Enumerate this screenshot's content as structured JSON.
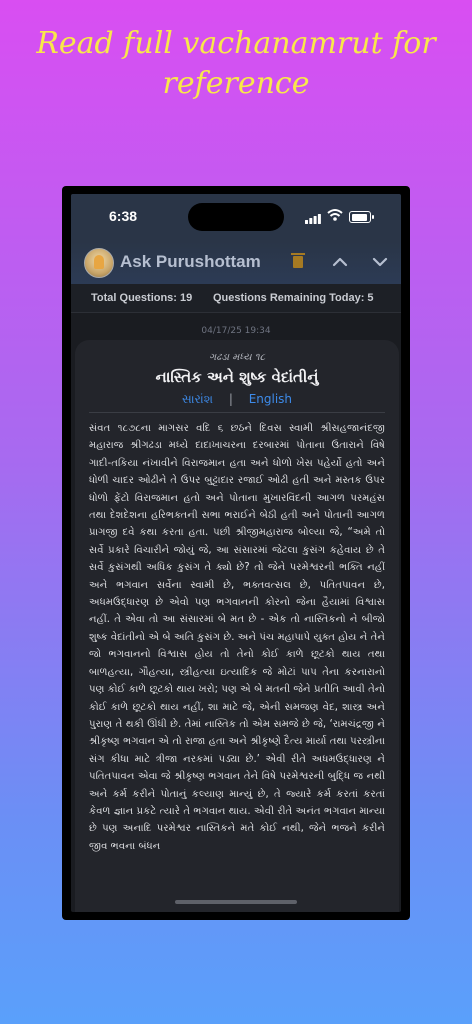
{
  "headline": "Read full vachanamrut for reference",
  "status": {
    "time": "6:38"
  },
  "app": {
    "title": "Ask Purushottam"
  },
  "icons": {
    "avatar": "profile-avatar-icon",
    "trash": "trash-icon",
    "up": "chevron-up-icon",
    "down": "chevron-down-icon"
  },
  "stats": {
    "total": "Total Questions: 19",
    "remaining": "Questions Remaining Today: 5"
  },
  "message": {
    "timestamp": "04/17/25 19:34",
    "reference": "ગઢડા મધ્ય ૧૮",
    "title": "નાસ્તિક અને શુષ્ક વેદાંતીનું",
    "lang_primary": "સારાંશ",
    "lang_separator": "|",
    "lang_secondary": "English",
    "body": "સંવત ૧૮૭૮ના માગસર વદિ ૬ છઠને દિવસ સ્વામી શ્રીસહજાનંદજી મહારાજ શ્રીગઢડા મધ્યે દાદાખાચરના દરબારમાં પોતાના ઉતારાને વિષે ગાદી-તકિયા નંખાવીને વિરાજમાન હતા અને ધોળો ખેસ પહેર્યો હતો અને ધોળી ચાદર ઓઢીને તે ઉપર બુટ્ટાદાર રજાઈ ઓઢી હતી અને મસ્તક ઉપર ધોળો ફેંટો વિરાજમાન હતો અને પોતાના મુખારવિંદની આગળ પરમહંસ તથા દેશદેશના હરિભક્તની સભા ભરાઈને બેઠી હતી અને પોતાની આગળ પ્રાગજી દવે કથા કરતા હતા. પછી શ્રીજીમહારાજ બોલ્યા જે, “અમે તો સર્વે પ્રકારે વિચારીને જોયું જે, આ સંસારમાં જેટલા કુસંગ કહેવાય છે તે સર્વે કુસંગથી અધિક કુસંગ તે ક્યો છે? તો જેને પરમેશ્વરની ભક્તિ નહીં અને ભગવાન સર્વેના સ્વામી છે, ભક્તવત્સલ છે, પતિતપાવન છે, અધમઉદ્ધારણ છે એવો પણ ભગવાનની કોરનો જેના હૈયામાં વિશ્વાસ નહીં. તે એવા તો આ સંસારમાં બે મત છે - એક તો નાસ્તિકનો ને બીજો શુષ્ક વેદાંતીનો એ બે અતિ કુસંગ છે. અને પંચ મહાપાપે યુક્ત હોય ને તેને જો ભગવાનનો વિશ્વાસ હોય તો તેનો કોઈ કાળે છૂટકો થાય તથા બાળહત્યા, ગૌહત્યા, સ્ત્રીહત્યા ઇત્યાદિક જે મોટાં પાપ તેના કરનારાનો પણ કોઈ કાળે છૂટકો થાય ખરો; પણ એ બે મતની જેને પ્રતીતિ આવી તેનો કોઈ કાળે છૂટકો થાય નહીં, શા માટે જે, એની સમજણ વેદ, શાસ્ત્ર અને પુરાણ તે થકી ઊંધી છે. તેમાં નાસ્તિક તો એમ સમજે છે જે, ‘રામચંદ્રજી ને શ્રીકૃષ્ણ ભગવાન એ તો રાજા હતા અને શ્રીકૃષ્ણે દૈત્ય માર્યા તથા પરસ્ત્રીના સંગ કીધા માટે ત્રીજા નરકમાં પડ્યા છે.’ એવી રીતે અધમઉદ્ધારણ ને પતિતપાવન એવા જે શ્રીકૃષ્ણ ભગવાન તેને વિષે પરમેશ્વરની બુદ્ધિ જ નથી અને કર્મ કરીને પોતાનું કલ્યાણ માન્યું છે, તે જ્યારે કર્મ કરતાં કરતાં કેવળ જ્ઞાન પ્રકટે ત્યારે તે ભગવાન થાય. એવી રીતે અનંત ભગવાન માન્યા છે પણ અનાદિ પરમેશ્વર નાસ્તિકને મતે કોઈ નથી, જેને ભજને કરીને જીવ ભવના બંધન"
  }
}
